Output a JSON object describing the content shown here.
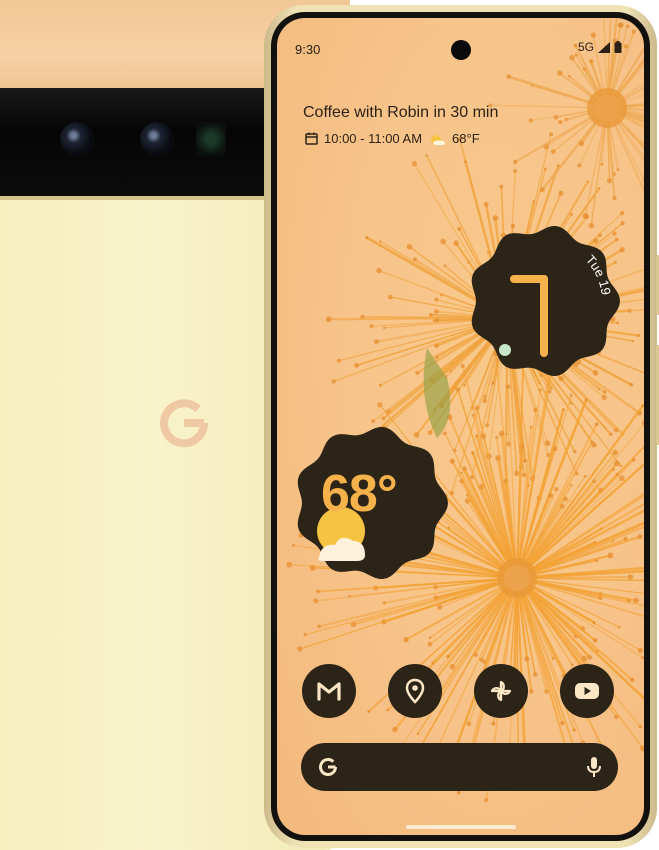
{
  "status_bar": {
    "time": "9:30",
    "network": "5G"
  },
  "at_a_glance": {
    "title": "Coffee with Robin in 30 min",
    "time_range": "10:00 - 11:00 AM",
    "temperature": "68°F",
    "icons": [
      "calendar-icon",
      "sun-icon"
    ]
  },
  "clock_widget": {
    "date": "Tue 19",
    "hour": 12,
    "minute": 30
  },
  "weather_widget": {
    "temperature": "68°"
  },
  "dock": {
    "apps": [
      {
        "name": "gmail",
        "icon": "gmail-icon"
      },
      {
        "name": "maps",
        "icon": "maps-pin-icon"
      },
      {
        "name": "photos",
        "icon": "pinwheel-icon"
      },
      {
        "name": "youtube",
        "icon": "youtube-icon"
      }
    ]
  },
  "search_bar": {
    "icons": [
      "google-g-icon",
      "microphone-icon"
    ]
  },
  "colors": {
    "widget_dark": "#2d2418",
    "accent_orange": "#f6b24a",
    "wallpaper": "#f7c48a",
    "back_body": "#f6efbe",
    "back_top": "#f2c796"
  }
}
